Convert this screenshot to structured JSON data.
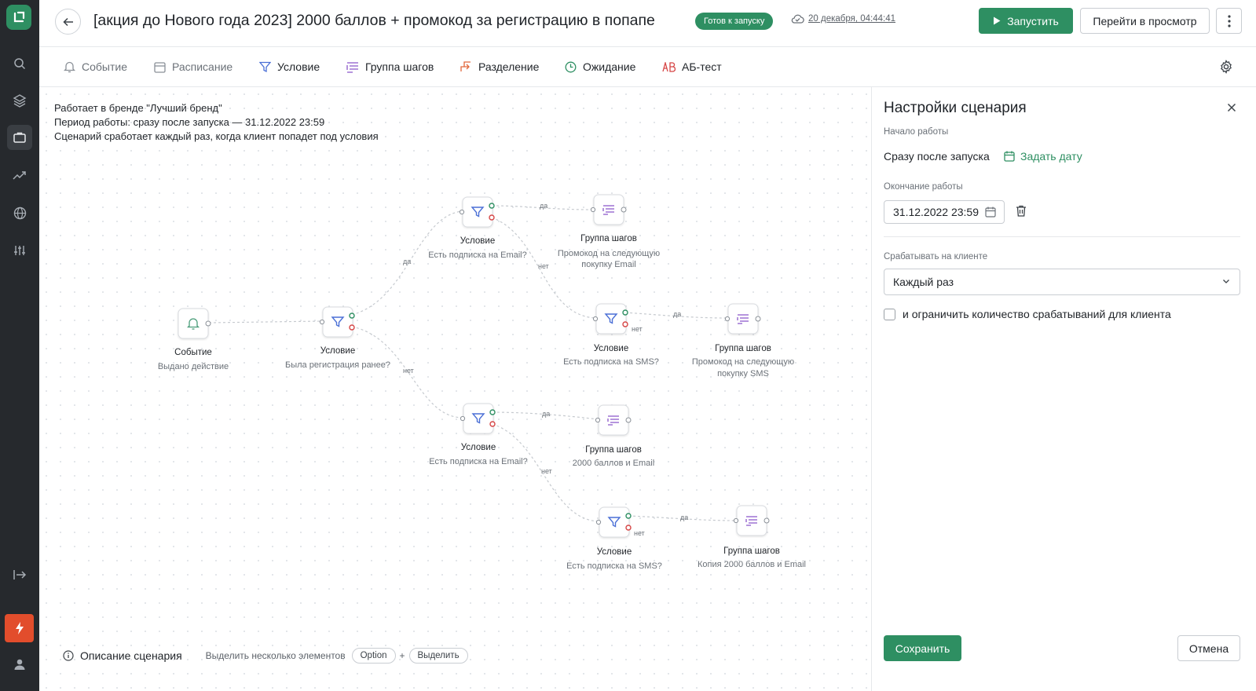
{
  "header": {
    "title": "[акция до Нового года 2023] 2000 баллов + промокод за регистрацию в попапе",
    "status_badge": "Готов к запуску",
    "saved_time": "20 декабря, 04:44:41",
    "run_label": "Запустить",
    "preview_label": "Перейти в просмотр"
  },
  "toolbar": {
    "items": [
      {
        "label": "Событие",
        "icon": "bell-icon"
      },
      {
        "label": "Расписание",
        "icon": "calendar-icon"
      },
      {
        "label": "Условие",
        "icon": "funnel-icon"
      },
      {
        "label": "Группа шагов",
        "icon": "step-group-icon"
      },
      {
        "label": "Разделение",
        "icon": "split-icon"
      },
      {
        "label": "Ожидание",
        "icon": "clock-icon"
      },
      {
        "label": "АБ-тест",
        "icon": "ab-icon"
      }
    ]
  },
  "canvas": {
    "info_lines": [
      "Работает в бренде \"Лучший бренд\"",
      "Период работы: сразу после запуска — 31.12.2022 23:59",
      "Сценарий сработает каждый раз, когда клиент попадет под условия"
    ],
    "nodes": {
      "event": {
        "title": "Событие",
        "subtitle": "Выдано действие"
      },
      "cond_reg": {
        "title": "Условие",
        "subtitle": "Была регистрация ранее?"
      },
      "cond_email_1": {
        "title": "Условие",
        "subtitle": "Есть подписка на Email?"
      },
      "group_1": {
        "title": "Группа шагов",
        "subtitle_1": "Промокод на следующую",
        "subtitle_2": "покупку Email"
      },
      "cond_sms_1": {
        "title": "Условие",
        "subtitle": "Есть подписка на SMS?"
      },
      "group_2": {
        "title": "Группа шагов",
        "subtitle_1": "Промокод на следующую",
        "subtitle_2": "покупку SMS"
      },
      "cond_email_2": {
        "title": "Условие",
        "subtitle": "Есть подписка на Email?"
      },
      "group_3": {
        "title": "Группа шагов",
        "subtitle": "2000 баллов и Email"
      },
      "cond_sms_2": {
        "title": "Условие",
        "subtitle": "Есть подписка на SMS?"
      },
      "group_4": {
        "title": "Группа шагов",
        "subtitle": "Копия 2000 баллов и Email"
      }
    },
    "edge_labels": {
      "yes": "да",
      "no": "нет"
    },
    "bottom": {
      "description_label": "Описание сценария",
      "multi_select_hint": "Выделить несколько элементов",
      "key_option": "Option",
      "plus": "+",
      "key_select": "Выделить"
    }
  },
  "panel": {
    "title": "Настройки сценария",
    "start_label": "Начало работы",
    "start_value": "Сразу после запуска",
    "set_date_label": "Задать дату",
    "end_label": "Окончание работы",
    "end_value": "31.12.2022 23:59",
    "trigger_label": "Срабатывать на клиенте",
    "trigger_value": "Каждый раз",
    "limit_checkbox_label": "и ограничить количество срабатываний для клиента",
    "save_label": "Сохранить",
    "cancel_label": "Отмена"
  },
  "colors": {
    "accent": "#2e8f62",
    "sidebar": "#26292d",
    "danger": "#e24d2c",
    "condition_icon": "#4a6fd6",
    "group_icon": "#8a56c9"
  }
}
